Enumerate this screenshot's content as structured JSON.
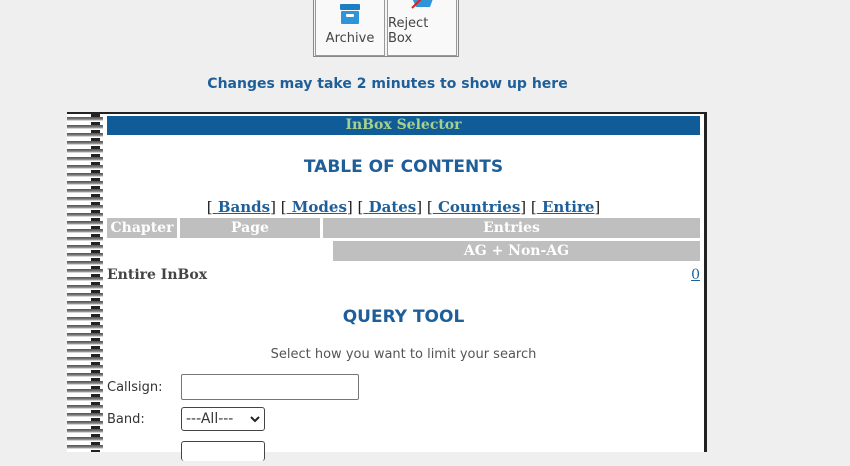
{
  "toolbar": {
    "archive_label": "Archive",
    "reject_label": "Reject Box"
  },
  "notice": "Changes may take 2 minutes to show up here",
  "selector": {
    "title": "InBox Selector"
  },
  "toc": {
    "title": "TABLE OF CONTENTS",
    "links": [
      "Bands",
      "Modes",
      "Dates",
      "Countries",
      "Entire"
    ],
    "headers": {
      "chapter": "Chapter",
      "page": "Page",
      "entries": "Entries"
    },
    "sub_header": "AG + Non-AG",
    "entire_row": {
      "label": "Entire InBox",
      "count": "0"
    }
  },
  "query": {
    "title": "QUERY TOOL",
    "help": "Select how you want to limit your search",
    "callsign_label": "Callsign:",
    "band_label": "Band:",
    "band_selected": "---All---"
  },
  "colors": {
    "accent": "#1f5f99",
    "selector_bg": "#0f5c99",
    "selector_text": "#a8d08d",
    "header_gray": "#bfbfbf"
  }
}
